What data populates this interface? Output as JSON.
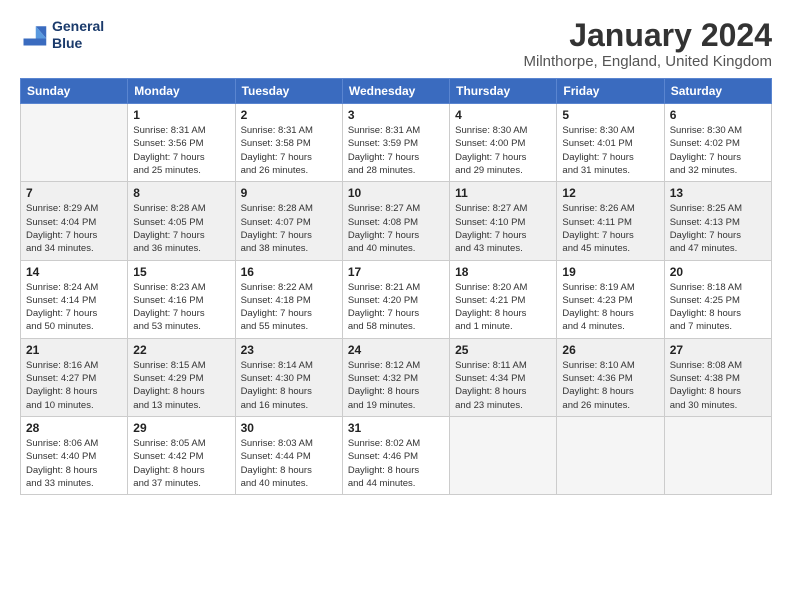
{
  "logo": {
    "line1": "General",
    "line2": "Blue"
  },
  "title": "January 2024",
  "subtitle": "Milnthorpe, England, United Kingdom",
  "days_of_week": [
    "Sunday",
    "Monday",
    "Tuesday",
    "Wednesday",
    "Thursday",
    "Friday",
    "Saturday"
  ],
  "weeks": [
    [
      {
        "day": "",
        "lines": []
      },
      {
        "day": "1",
        "lines": [
          "Sunrise: 8:31 AM",
          "Sunset: 3:56 PM",
          "Daylight: 7 hours",
          "and 25 minutes."
        ]
      },
      {
        "day": "2",
        "lines": [
          "Sunrise: 8:31 AM",
          "Sunset: 3:58 PM",
          "Daylight: 7 hours",
          "and 26 minutes."
        ]
      },
      {
        "day": "3",
        "lines": [
          "Sunrise: 8:31 AM",
          "Sunset: 3:59 PM",
          "Daylight: 7 hours",
          "and 28 minutes."
        ]
      },
      {
        "day": "4",
        "lines": [
          "Sunrise: 8:30 AM",
          "Sunset: 4:00 PM",
          "Daylight: 7 hours",
          "and 29 minutes."
        ]
      },
      {
        "day": "5",
        "lines": [
          "Sunrise: 8:30 AM",
          "Sunset: 4:01 PM",
          "Daylight: 7 hours",
          "and 31 minutes."
        ]
      },
      {
        "day": "6",
        "lines": [
          "Sunrise: 8:30 AM",
          "Sunset: 4:02 PM",
          "Daylight: 7 hours",
          "and 32 minutes."
        ]
      }
    ],
    [
      {
        "day": "7",
        "lines": [
          "Sunrise: 8:29 AM",
          "Sunset: 4:04 PM",
          "Daylight: 7 hours",
          "and 34 minutes."
        ]
      },
      {
        "day": "8",
        "lines": [
          "Sunrise: 8:28 AM",
          "Sunset: 4:05 PM",
          "Daylight: 7 hours",
          "and 36 minutes."
        ]
      },
      {
        "day": "9",
        "lines": [
          "Sunrise: 8:28 AM",
          "Sunset: 4:07 PM",
          "Daylight: 7 hours",
          "and 38 minutes."
        ]
      },
      {
        "day": "10",
        "lines": [
          "Sunrise: 8:27 AM",
          "Sunset: 4:08 PM",
          "Daylight: 7 hours",
          "and 40 minutes."
        ]
      },
      {
        "day": "11",
        "lines": [
          "Sunrise: 8:27 AM",
          "Sunset: 4:10 PM",
          "Daylight: 7 hours",
          "and 43 minutes."
        ]
      },
      {
        "day": "12",
        "lines": [
          "Sunrise: 8:26 AM",
          "Sunset: 4:11 PM",
          "Daylight: 7 hours",
          "and 45 minutes."
        ]
      },
      {
        "day": "13",
        "lines": [
          "Sunrise: 8:25 AM",
          "Sunset: 4:13 PM",
          "Daylight: 7 hours",
          "and 47 minutes."
        ]
      }
    ],
    [
      {
        "day": "14",
        "lines": [
          "Sunrise: 8:24 AM",
          "Sunset: 4:14 PM",
          "Daylight: 7 hours",
          "and 50 minutes."
        ]
      },
      {
        "day": "15",
        "lines": [
          "Sunrise: 8:23 AM",
          "Sunset: 4:16 PM",
          "Daylight: 7 hours",
          "and 53 minutes."
        ]
      },
      {
        "day": "16",
        "lines": [
          "Sunrise: 8:22 AM",
          "Sunset: 4:18 PM",
          "Daylight: 7 hours",
          "and 55 minutes."
        ]
      },
      {
        "day": "17",
        "lines": [
          "Sunrise: 8:21 AM",
          "Sunset: 4:20 PM",
          "Daylight: 7 hours",
          "and 58 minutes."
        ]
      },
      {
        "day": "18",
        "lines": [
          "Sunrise: 8:20 AM",
          "Sunset: 4:21 PM",
          "Daylight: 8 hours",
          "and 1 minute."
        ]
      },
      {
        "day": "19",
        "lines": [
          "Sunrise: 8:19 AM",
          "Sunset: 4:23 PM",
          "Daylight: 8 hours",
          "and 4 minutes."
        ]
      },
      {
        "day": "20",
        "lines": [
          "Sunrise: 8:18 AM",
          "Sunset: 4:25 PM",
          "Daylight: 8 hours",
          "and 7 minutes."
        ]
      }
    ],
    [
      {
        "day": "21",
        "lines": [
          "Sunrise: 8:16 AM",
          "Sunset: 4:27 PM",
          "Daylight: 8 hours",
          "and 10 minutes."
        ]
      },
      {
        "day": "22",
        "lines": [
          "Sunrise: 8:15 AM",
          "Sunset: 4:29 PM",
          "Daylight: 8 hours",
          "and 13 minutes."
        ]
      },
      {
        "day": "23",
        "lines": [
          "Sunrise: 8:14 AM",
          "Sunset: 4:30 PM",
          "Daylight: 8 hours",
          "and 16 minutes."
        ]
      },
      {
        "day": "24",
        "lines": [
          "Sunrise: 8:12 AM",
          "Sunset: 4:32 PM",
          "Daylight: 8 hours",
          "and 19 minutes."
        ]
      },
      {
        "day": "25",
        "lines": [
          "Sunrise: 8:11 AM",
          "Sunset: 4:34 PM",
          "Daylight: 8 hours",
          "and 23 minutes."
        ]
      },
      {
        "day": "26",
        "lines": [
          "Sunrise: 8:10 AM",
          "Sunset: 4:36 PM",
          "Daylight: 8 hours",
          "and 26 minutes."
        ]
      },
      {
        "day": "27",
        "lines": [
          "Sunrise: 8:08 AM",
          "Sunset: 4:38 PM",
          "Daylight: 8 hours",
          "and 30 minutes."
        ]
      }
    ],
    [
      {
        "day": "28",
        "lines": [
          "Sunrise: 8:06 AM",
          "Sunset: 4:40 PM",
          "Daylight: 8 hours",
          "and 33 minutes."
        ]
      },
      {
        "day": "29",
        "lines": [
          "Sunrise: 8:05 AM",
          "Sunset: 4:42 PM",
          "Daylight: 8 hours",
          "and 37 minutes."
        ]
      },
      {
        "day": "30",
        "lines": [
          "Sunrise: 8:03 AM",
          "Sunset: 4:44 PM",
          "Daylight: 8 hours",
          "and 40 minutes."
        ]
      },
      {
        "day": "31",
        "lines": [
          "Sunrise: 8:02 AM",
          "Sunset: 4:46 PM",
          "Daylight: 8 hours",
          "and 44 minutes."
        ]
      },
      {
        "day": "",
        "lines": []
      },
      {
        "day": "",
        "lines": []
      },
      {
        "day": "",
        "lines": []
      }
    ]
  ]
}
